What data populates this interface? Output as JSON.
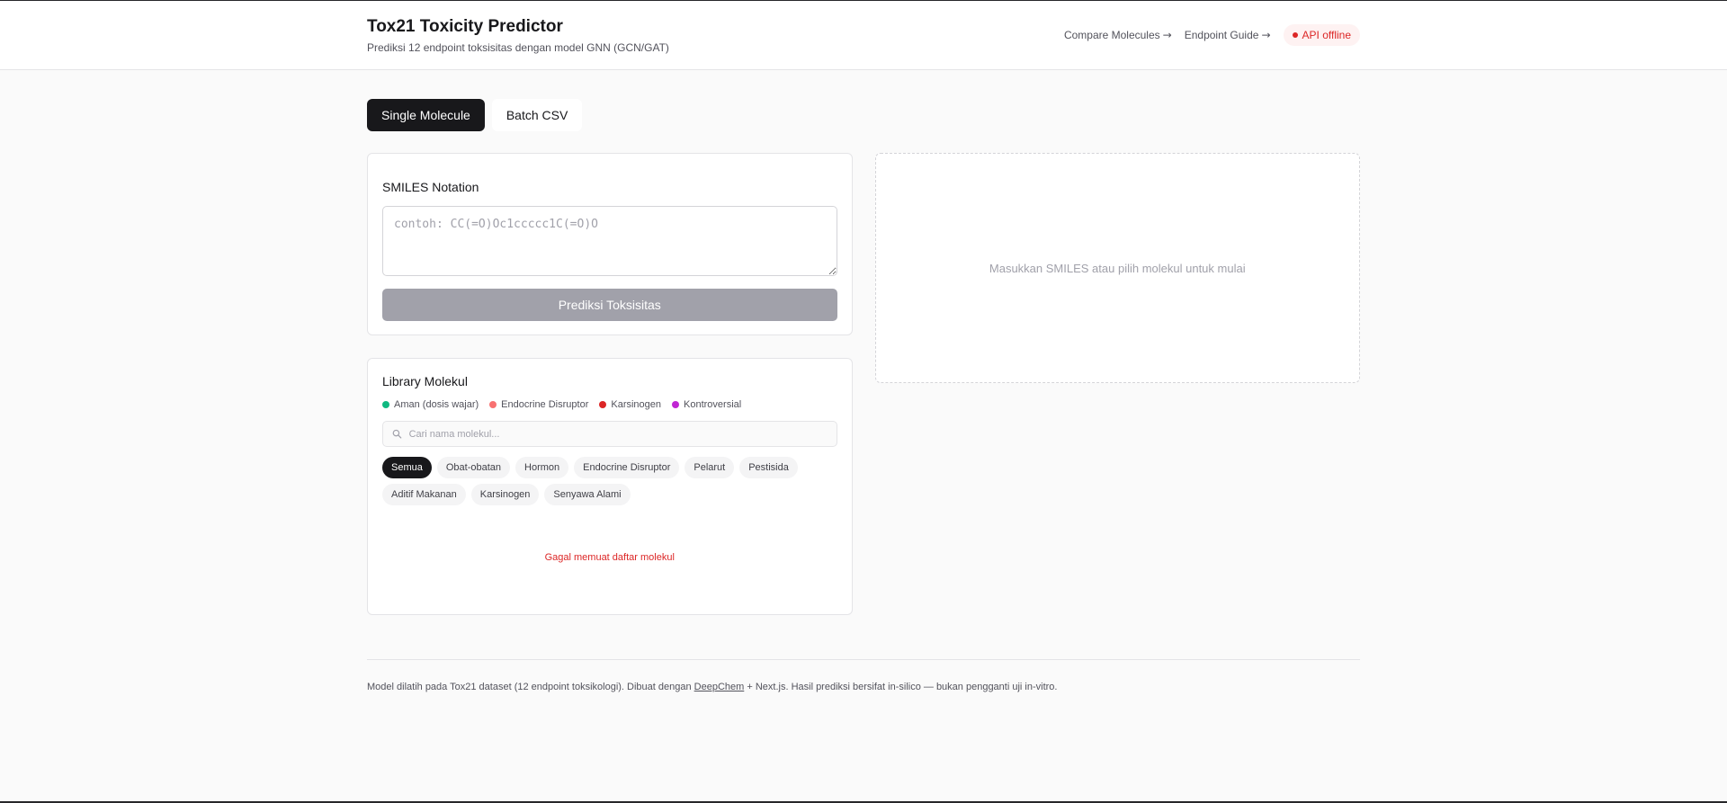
{
  "header": {
    "title": "Tox21 Toxicity Predictor",
    "subtitle": "Prediksi 12 endpoint toksisitas dengan model GNN (GCN/GAT)",
    "nav": [
      {
        "label": "Compare Molecules",
        "arrow": "→"
      },
      {
        "label": "Endpoint Guide",
        "arrow": "→"
      }
    ],
    "api_status": "API offline"
  },
  "tabs": [
    {
      "label": "Single Molecule",
      "active": true
    },
    {
      "label": "Batch CSV",
      "active": false
    }
  ],
  "smiles_card": {
    "title": "SMILES Notation",
    "placeholder": "contoh: CC(=O)Oc1ccccc1C(=O)O",
    "value": "",
    "button_label": "Prediksi Toksisitas"
  },
  "library_card": {
    "title": "Library Molekul",
    "legend": [
      {
        "label": "Aman (dosis wajar)",
        "color": "#10b981"
      },
      {
        "label": "Endocrine Disruptor",
        "color": "#f87171"
      },
      {
        "label": "Karsinogen",
        "color": "#dc2626"
      },
      {
        "label": "Kontroversial",
        "color": "#c026d3"
      }
    ],
    "search_placeholder": "Cari nama molekul...",
    "chips": [
      "Semua",
      "Obat-obatan",
      "Hormon",
      "Endocrine Disruptor",
      "Pelarut",
      "Pestisida",
      "Aditif Makanan",
      "Karsinogen",
      "Senyawa Alami"
    ],
    "error": "Gagal memuat daftar molekul"
  },
  "result_panel": {
    "message": "Masukkan SMILES atau pilih molekul untuk mulai"
  },
  "footer": {
    "text_before": "Model dilatih pada Tox21 dataset (12 endpoint toksikologi). Dibuat dengan ",
    "link": "DeepChem",
    "text_after": " + Next.js. Hasil prediksi bersifat in-silico — bukan pengganti uji in-vitro."
  },
  "colors": {
    "primary": "#18181b",
    "danger": "#dc2626",
    "muted": "#a1a1aa"
  }
}
